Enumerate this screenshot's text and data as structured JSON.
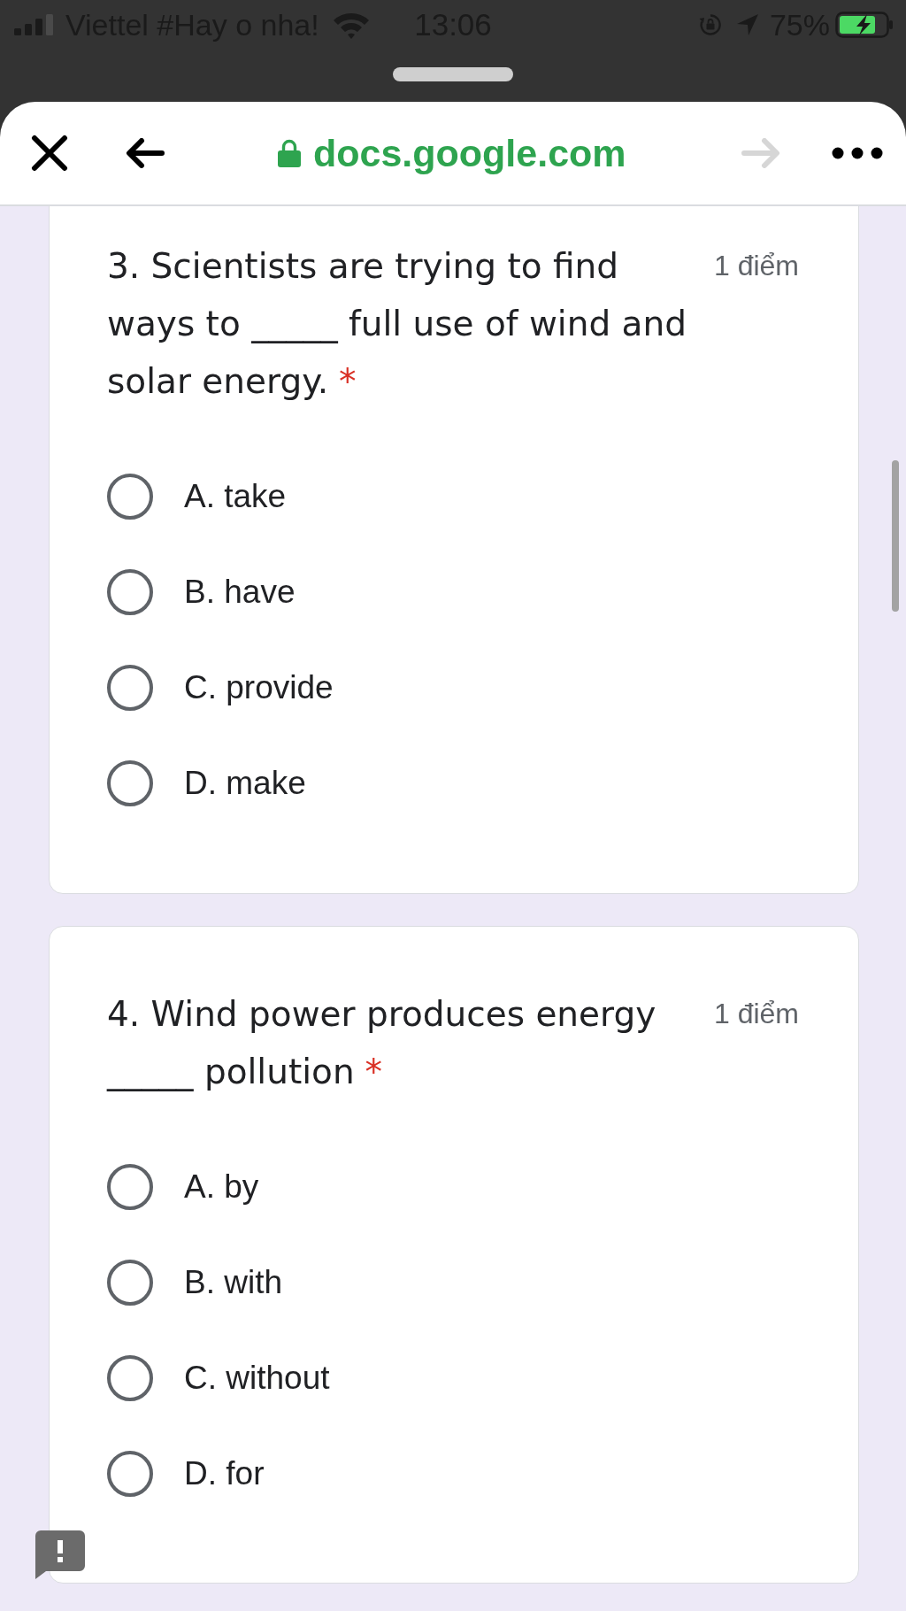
{
  "status_bar": {
    "carrier": "Viettel #Hay o nha!",
    "time": "13:06",
    "battery": "75%"
  },
  "browser_toolbar": {
    "url": "docs.google.com",
    "forward": {
      "disabled": true
    }
  },
  "questions": [
    {
      "title": "3. Scientists are trying to find ways to _____ full use of wind and solar energy.",
      "required_mark": "*",
      "points": "1 điểm",
      "options": [
        {
          "label": "A. take",
          "selected": false
        },
        {
          "label": "B. have",
          "selected": false
        },
        {
          "label": "C. provide",
          "selected": false
        },
        {
          "label": "D. make",
          "selected": false
        }
      ]
    },
    {
      "title": "4. Wind power produces energy _____ pollution",
      "required_mark": "*",
      "points": "1 điểm",
      "options": [
        {
          "label": "A. by",
          "selected": false
        },
        {
          "label": "B. with",
          "selected": false
        },
        {
          "label": "C. without",
          "selected": false
        },
        {
          "label": "D. for",
          "selected": false
        }
      ]
    }
  ]
}
